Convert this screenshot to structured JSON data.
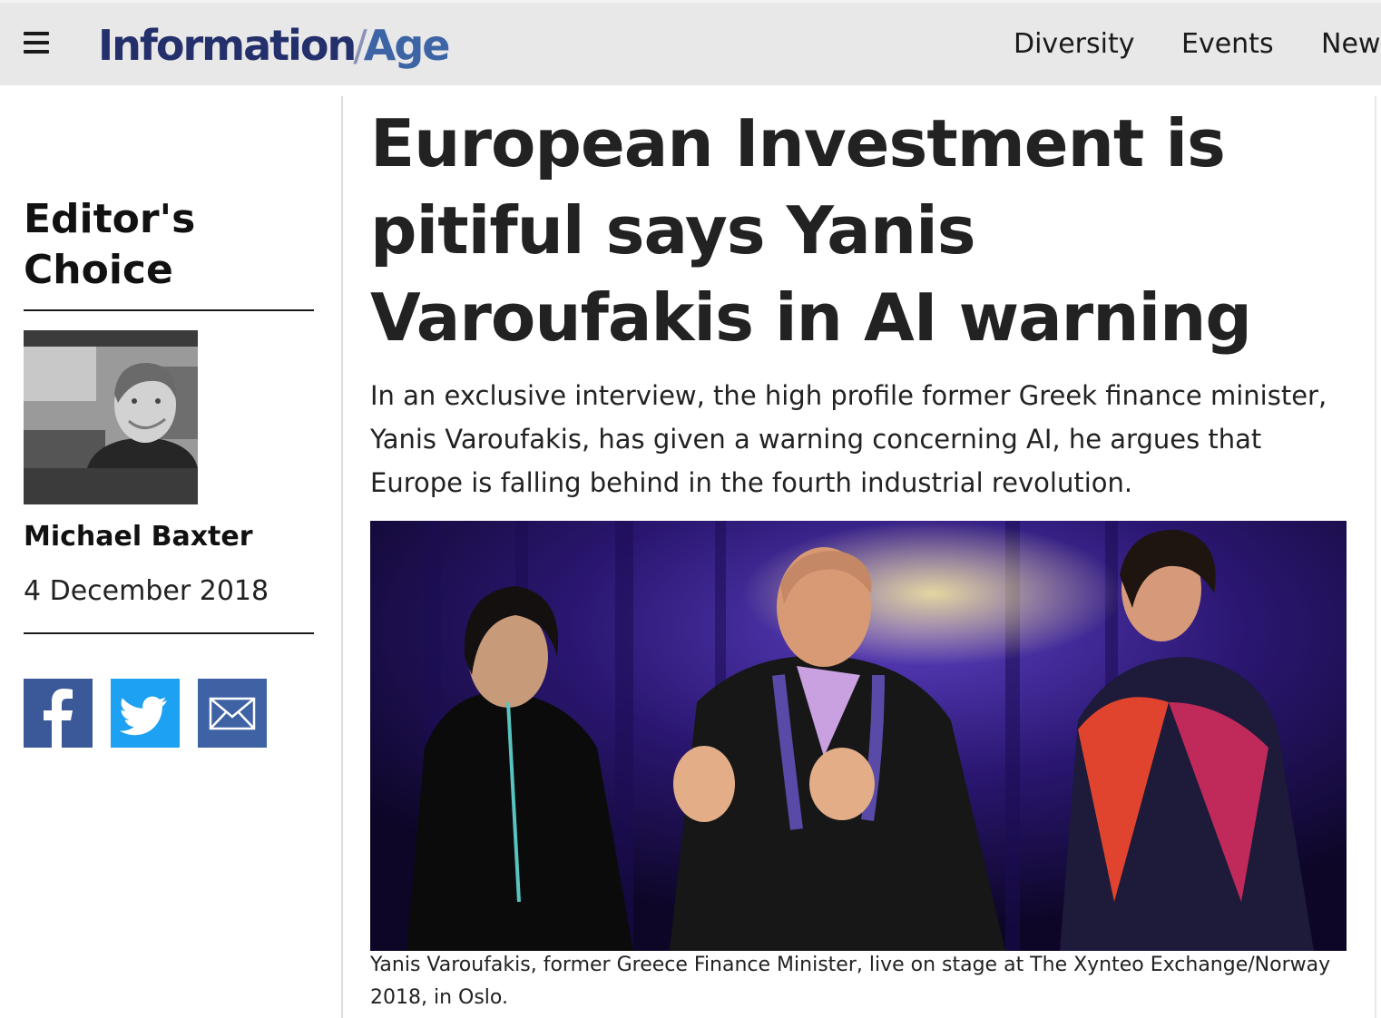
{
  "header": {
    "logo_part1": "Information",
    "logo_part2": "Age",
    "nav": [
      "Diversity",
      "Events",
      "New"
    ],
    "menu_icon": "hamburger-menu-icon"
  },
  "sidebar": {
    "section_title": "Editor's Choice",
    "author_name": "Michael Baxter",
    "date": "4 December 2018",
    "share_icons": [
      "facebook-icon",
      "twitter-icon",
      "email-icon"
    ],
    "colors": {
      "facebook": "#3b5998",
      "twitter": "#1da1f2",
      "email": "#3f62a5"
    }
  },
  "article": {
    "headline": "European Investment is pitiful says Yanis Varoufakis in AI warning",
    "standfirst": "In an exclusive interview, the high profile former Greek finance minister, Yanis Varoufakis, has given a warning concerning AI, he argues that Europe is falling behind in the fourth industrial revolution.",
    "caption": "Yanis Varoufakis, former Greece Finance Minister, live on stage at The Xynteo Exchange/Norway 2018, in Oslo."
  },
  "brand_colors": {
    "logo_primary": "#24306b",
    "logo_secondary": "#3d65a6",
    "header_bg": "#e8e8e8"
  }
}
